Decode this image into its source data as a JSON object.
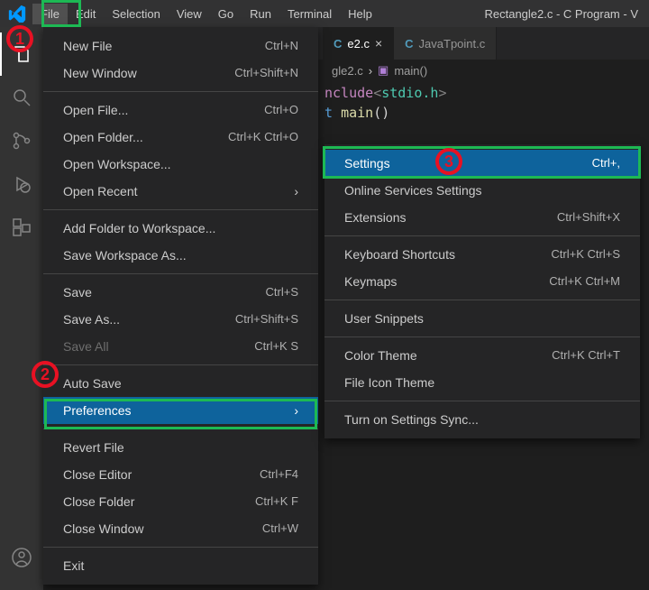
{
  "title": "Rectangle2.c - C Program - V",
  "menubar": [
    "File",
    "Edit",
    "Selection",
    "View",
    "Go",
    "Run",
    "Terminal",
    "Help"
  ],
  "tabs": [
    {
      "label": "e2.c",
      "active": true
    },
    {
      "label": "JavaTpoint.c",
      "active": false
    }
  ],
  "breadcrumb": {
    "file": "gle2.c",
    "symbol": "main()"
  },
  "code": {
    "inc_kw": "nclude",
    "inc_open": "<",
    "inc_lib": "stdio.h",
    "inc_close": ">",
    "ret": "t",
    "fn": "main",
    "paren": "()"
  },
  "file_menu": [
    {
      "label": "New File",
      "sc": "Ctrl+N"
    },
    {
      "label": "New Window",
      "sc": "Ctrl+Shift+N"
    },
    {
      "sep": true
    },
    {
      "label": "Open File...",
      "sc": "Ctrl+O"
    },
    {
      "label": "Open Folder...",
      "sc": "Ctrl+K Ctrl+O"
    },
    {
      "label": "Open Workspace..."
    },
    {
      "label": "Open Recent",
      "sub": true
    },
    {
      "sep": true
    },
    {
      "label": "Add Folder to Workspace..."
    },
    {
      "label": "Save Workspace As..."
    },
    {
      "sep": true
    },
    {
      "label": "Save",
      "sc": "Ctrl+S"
    },
    {
      "label": "Save As...",
      "sc": "Ctrl+Shift+S"
    },
    {
      "label": "Save All",
      "sc": "Ctrl+K S",
      "disabled": true
    },
    {
      "sep": true
    },
    {
      "label": "Auto Save"
    },
    {
      "label": "Preferences",
      "sub": true,
      "highlight": true
    },
    {
      "sep": true
    },
    {
      "label": "Revert File"
    },
    {
      "label": "Close Editor",
      "sc": "Ctrl+F4"
    },
    {
      "label": "Close Folder",
      "sc": "Ctrl+K F"
    },
    {
      "label": "Close Window",
      "sc": "Ctrl+W"
    },
    {
      "sep": true
    },
    {
      "label": "Exit"
    }
  ],
  "pref_menu": [
    {
      "label": "Settings",
      "sc": "Ctrl+,",
      "highlight": true
    },
    {
      "label": "Online Services Settings"
    },
    {
      "label": "Extensions",
      "sc": "Ctrl+Shift+X"
    },
    {
      "sep": true
    },
    {
      "label": "Keyboard Shortcuts",
      "sc": "Ctrl+K Ctrl+S"
    },
    {
      "label": "Keymaps",
      "sc": "Ctrl+K Ctrl+M"
    },
    {
      "sep": true
    },
    {
      "label": "User Snippets"
    },
    {
      "sep": true
    },
    {
      "label": "Color Theme",
      "sc": "Ctrl+K Ctrl+T"
    },
    {
      "label": "File Icon Theme"
    },
    {
      "sep": true
    },
    {
      "label": "Turn on Settings Sync..."
    }
  ],
  "annotations": {
    "a1": "1",
    "a2": "2",
    "a3": "3"
  }
}
